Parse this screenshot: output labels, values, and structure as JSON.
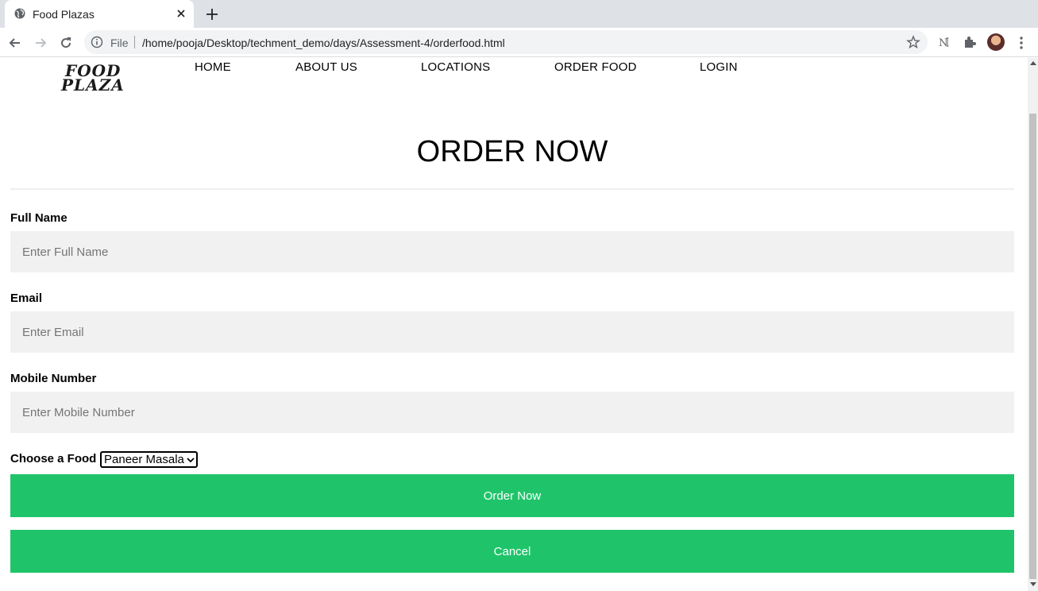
{
  "browser": {
    "tab_title": "Food Plazas",
    "scheme_label": "File",
    "url": "/home/pooja/Desktop/techment_demo/days/Assessment-4/orderfood.html"
  },
  "site": {
    "logo_line1": "FOOD",
    "logo_line2": "PLAZA",
    "nav": [
      "HOME",
      "ABOUT US",
      "LOCATIONS",
      "ORDER FOOD",
      "LOGIN"
    ]
  },
  "form": {
    "heading": "ORDER NOW",
    "full_name_label": "Full Name",
    "full_name_placeholder": "Enter Full Name",
    "email_label": "Email",
    "email_placeholder": "Enter Email",
    "mobile_label": "Mobile Number",
    "mobile_placeholder": "Enter Mobile Number",
    "food_label": "Choose a Food",
    "food_selected": "Paneer Masala",
    "order_button": "Order Now",
    "cancel_button": "Cancel"
  },
  "colors": {
    "button_green": "#1fc46a",
    "input_bg": "#f1f1f1"
  }
}
